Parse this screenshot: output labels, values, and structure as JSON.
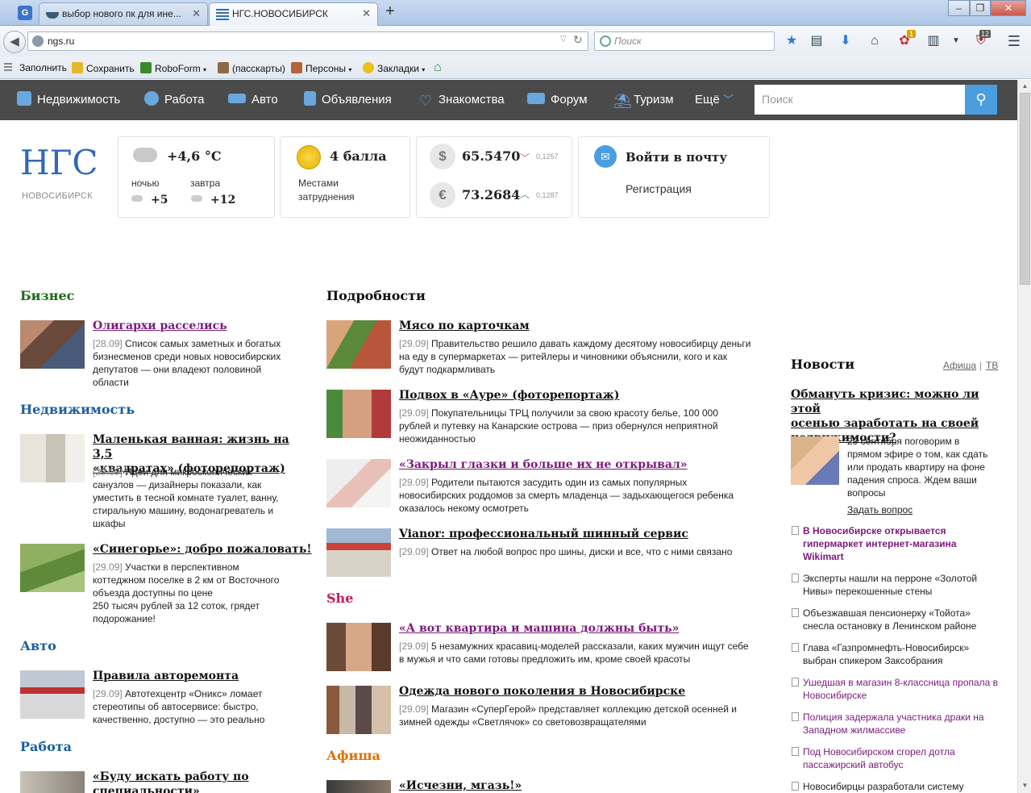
{
  "browser": {
    "tabs": [
      {
        "label": "выбор нового пк для ине...",
        "active": false
      },
      {
        "label": "НГС.НОВОСИБИРСК",
        "active": true
      }
    ],
    "new_tab": "+",
    "url": "ngs.ru",
    "search_placeholder": "Поиск",
    "badges": {
      "addon": "1",
      "ublock": "12"
    },
    "bookmarks": [
      "Заполнить",
      "Сохранить",
      "RoboForm",
      "(пасскарты)",
      "Персоны",
      "Закладки"
    ]
  },
  "sitenav": {
    "items": [
      "Недвижимость",
      "Работа",
      "Авто",
      "Объявления",
      "Знакомства",
      "Форум",
      "Туризм",
      "Ещё"
    ],
    "search_placeholder": "Поиск"
  },
  "logo": {
    "city": "НОВОСИБИРСК",
    "mark": "НГС"
  },
  "weather": {
    "now": "+4,6 °С",
    "night_label": "ночью",
    "night": "+5",
    "tomorrow_label": "завтра",
    "tomorrow": "+12"
  },
  "traffic": {
    "score": "4 балла",
    "desc1": "Местами",
    "desc2": "затруднения"
  },
  "currency": {
    "usd_symbol": "$",
    "usd": "65.5470",
    "usd_change": "0,1257",
    "eur_symbol": "€",
    "eur": "73.2684",
    "eur_change": "0,1287"
  },
  "mail": {
    "login": "Войти в почту",
    "register": "Регистрация"
  },
  "left": {
    "biz": {
      "head": "Бизнес",
      "title": "Олигархи расселись",
      "date": "[28.09]",
      "text": [
        "Список самых заметных и богатых",
        "бизнесменов среди новых новосибирских",
        "депутатов — они владеют половиной",
        "области"
      ]
    },
    "realty": {
      "head": "Недвижимость",
      "a1": {
        "title1": "Маленькая ванная: жизнь на 3,5",
        "title2": "«квадратах» (фоторепортаж)",
        "date": "[29.09]",
        "text": [
          "Идеи для микроскопических",
          "санузлов — дизайнеры показали, как",
          "уместить в тесной комнате туалет, ванну,",
          "стиральную машину, водонагреватель и",
          "шкафы"
        ]
      },
      "a2": {
        "title": "«Синегорье»: добро пожаловать!",
        "date": "[29.09]",
        "text": [
          "Участки в перспективном",
          "коттеджном поселке в 2 км от Восточного",
          "объезда доступны по цене",
          "250 тысяч рублей за 12 соток, грядет",
          "подорожание!"
        ]
      }
    },
    "auto": {
      "head": "Авто",
      "title": "Правила авторемонта",
      "date": "[29.09]",
      "text": [
        "Автотехцентр «Оникс» ломает",
        "стереотипы об автосервисе: быстро,",
        "качественно, доступно — это реально"
      ]
    },
    "work": {
      "head": "Работа",
      "title1": "«Буду искать работу по",
      "title2": "специальности»"
    }
  },
  "middle": {
    "head": "Подробности",
    "a1": {
      "title": "Мясо по карточкам",
      "date": "[29.09]",
      "text": [
        "Правительство решило давать каждому десятому новосибирцу деньги",
        "на еду в супермаркетах — ритейлеры и чиновники объяснили, кого и как",
        "будут подкармливать"
      ]
    },
    "a2": {
      "title": "Подвох в «Ауре» (фоторепортаж)",
      "date": "[29.09]",
      "text": [
        "Покупательницы ТРЦ получили за свою красоту белье, 100 000",
        "рублей и путевку на Канарские острова — приз обернулся неприятной",
        "неожиданностью"
      ]
    },
    "a3": {
      "title": "«Закрыл глазки и больше их не открывал»",
      "date": "[29.09]",
      "text": [
        "Родители пытаются засудить один из самых популярных",
        "новосибирских роддомов за смерть младенца — задыхающегося ребенка",
        "оказалось некому осмотреть"
      ]
    },
    "a4": {
      "title": "Vianor: профессиональный шинный сервис",
      "date": "[29.09]",
      "text": [
        "Ответ на любой вопрос про шины, диски и все, что с ними связано"
      ]
    },
    "she": {
      "head": "She",
      "a1": {
        "title": "«А вот квартира и машина должны быть»",
        "date": "[29.09]",
        "text": [
          "5 незамужних красавиц-моделей рассказали, каких мужчин ищут себе",
          "в мужья и что сами готовы предложить им, кроме своей красоты"
        ]
      },
      "a2": {
        "title": "Одежда нового поколения в Новосибирске",
        "date": "[29.09]",
        "text": [
          "Магазин «СуперГерой» представляет коллекцию детской осенней и",
          "зимней одежды «Светлячок» со световозвращателями"
        ]
      }
    },
    "afisha": {
      "head": "Афиша",
      "title": "«Исчезни, мгазь!»"
    }
  },
  "right": {
    "head": "Новости",
    "link1": "Афиша",
    "sep": "|",
    "link2": "ТВ",
    "feature": {
      "title": [
        "Обмануть кризис: можно ли этой",
        "осенью заработать на своей",
        "недвижимости?"
      ],
      "text": [
        "29 сентября поговорим в",
        "прямом эфире о том, как сдать",
        "или продать квартиру на фоне",
        "падения спроса. Ждем ваши",
        "вопросы"
      ],
      "ask": "Задать вопрос"
    },
    "news": [
      {
        "lines": [
          "В Новосибирске открывается",
          "гипермаркет интернет-магазина",
          "Wikimart"
        ],
        "bold": true,
        "visited": true
      },
      {
        "lines": [
          "Эксперты нашли на перроне «Золотой",
          "Нивы» перекошенные стены"
        ],
        "visited": false
      },
      {
        "lines": [
          "Объезжавшая пенсионерку «Тойота»",
          "снесла остановку в Ленинском районе"
        ],
        "visited": false
      },
      {
        "lines": [
          "Глава «Газпромнефть-Новосибирск»",
          "выбран спикером Заксобрания"
        ],
        "visited": false
      },
      {
        "lines": [
          "Ушедшая в магазин 8-классница пропала в",
          "Новосибирске"
        ],
        "visited": true
      },
      {
        "lines": [
          "Полиция задержала участника драки на",
          "Западном жилмассиве"
        ],
        "visited": true
      },
      {
        "lines": [
          "Под Новосибирском сгорел дотла",
          "пассажирский автобус"
        ],
        "visited": true
      },
      {
        "lines": [
          "Новосибирцы разработали систему"
        ],
        "visited": false
      }
    ]
  },
  "colors": {
    "nav_bg": "#4a4a4a",
    "biz": "#1a6b1a",
    "realty": "#1a5fa0",
    "she": "#c2185b",
    "afisha": "#e07000",
    "visited": "#7a1a7a",
    "accent": "#4a9ee0"
  }
}
